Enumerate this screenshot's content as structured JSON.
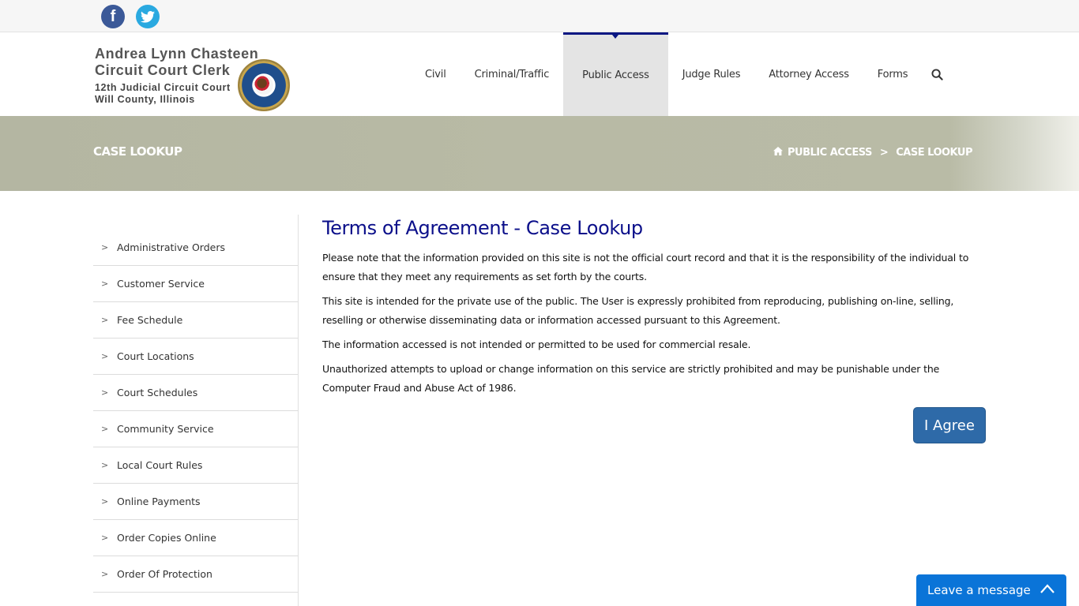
{
  "social": {
    "facebook_icon": "facebook-icon",
    "twitter_icon": "twitter-icon"
  },
  "logo": {
    "line1": "Andrea Lynn Chasteen",
    "line2": "Circuit Court Clerk",
    "line3": "12th Judicial Circuit Court",
    "line4": "Will County, Illinois"
  },
  "nav": {
    "items": [
      {
        "label": "Civil"
      },
      {
        "label": "Criminal/Traffic"
      },
      {
        "label": "Public Access",
        "active": true
      },
      {
        "label": "Judge Rules"
      },
      {
        "label": "Attorney Access"
      },
      {
        "label": "Forms"
      }
    ],
    "search_icon": "search-icon"
  },
  "banner": {
    "title": "CASE LOOKUP",
    "breadcrumb": {
      "home_icon": "home-icon",
      "items": [
        "PUBLIC ACCESS",
        "CASE LOOKUP"
      ],
      "separator": ">"
    }
  },
  "sidebar": {
    "items": [
      {
        "label": "Administrative Orders"
      },
      {
        "label": "Customer Service"
      },
      {
        "label": "Fee Schedule"
      },
      {
        "label": "Court Locations"
      },
      {
        "label": "Court Schedules"
      },
      {
        "label": "Community Service"
      },
      {
        "label": "Local Court Rules"
      },
      {
        "label": "Online Payments"
      },
      {
        "label": "Order Copies Online"
      },
      {
        "label": "Order Of Protection"
      }
    ]
  },
  "main": {
    "title": "Terms of Agreement - Case Lookup",
    "paragraphs": [
      "Please note that the information provided on this site is not the official court record and that it is the responsibility of the individual to ensure that they meet any requirements as set forth by the courts.",
      "This site is intended for the private use of the public. The User is expressly prohibited from reproducing, publishing on-line, selling, reselling or otherwise disseminating data or information accessed pursuant to this Agreement.",
      "The information accessed is not intended or permitted to be used for commercial resale.",
      "Unauthorized attempts to upload or change information on this service are strictly prohibited and may be punishable under the Computer Fraud and Abuse Act of 1986."
    ],
    "agree_label": "I Agree"
  },
  "chat": {
    "label": "Leave a message"
  },
  "colors": {
    "nav_active_border": "#0a1782",
    "title": "#0b0f8a",
    "agree_button": "#2e6aa8",
    "chat_widget": "#0a74d8",
    "banner": "#b8baa5"
  }
}
